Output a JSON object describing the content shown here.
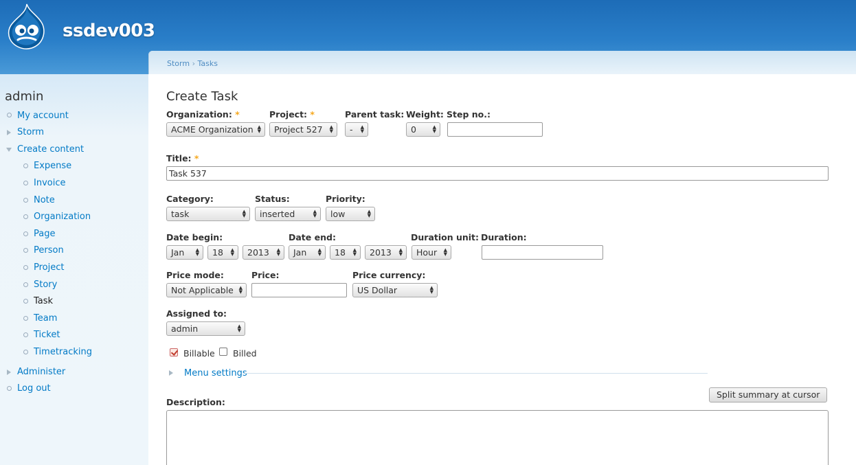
{
  "site": {
    "name": "ssdev003"
  },
  "sidebar": {
    "title": "admin",
    "items": [
      {
        "label": "My account"
      },
      {
        "label": "Storm"
      },
      {
        "label": "Create content"
      },
      {
        "label": "Expense"
      },
      {
        "label": "Invoice"
      },
      {
        "label": "Note"
      },
      {
        "label": "Organization"
      },
      {
        "label": "Page"
      },
      {
        "label": "Person"
      },
      {
        "label": "Project"
      },
      {
        "label": "Story"
      },
      {
        "label": "Task"
      },
      {
        "label": "Team"
      },
      {
        "label": "Ticket"
      },
      {
        "label": "Timetracking"
      },
      {
        "label": "Administer"
      },
      {
        "label": "Log out"
      }
    ]
  },
  "breadcrumb": {
    "root": "Storm",
    "separator": "›",
    "current": "Tasks"
  },
  "page": {
    "title": "Create Task"
  },
  "form": {
    "required_mark": "*",
    "organization": {
      "label": "Organization:",
      "value": "ACME Organization"
    },
    "project": {
      "label": "Project:",
      "value": "Project 527"
    },
    "parent_task": {
      "label": "Parent task:",
      "value": "-"
    },
    "weight": {
      "label": "Weight:",
      "value": "0"
    },
    "step_no": {
      "label": "Step no.:",
      "value": ""
    },
    "title": {
      "label": "Title:",
      "value": "Task 537"
    },
    "category": {
      "label": "Category:",
      "value": "task"
    },
    "status": {
      "label": "Status:",
      "value": "inserted"
    },
    "priority": {
      "label": "Priority:",
      "value": "low"
    },
    "date_begin": {
      "label": "Date begin:",
      "month": "Jan",
      "day": "18",
      "year": "2013"
    },
    "date_end": {
      "label": "Date end:",
      "month": "Jan",
      "day": "18",
      "year": "2013"
    },
    "duration_unit": {
      "label": "Duration unit:",
      "value": "Hour"
    },
    "duration": {
      "label": "Duration:",
      "value": ""
    },
    "price_mode": {
      "label": "Price mode:",
      "value": "Not Applicable"
    },
    "price": {
      "label": "Price:",
      "value": ""
    },
    "price_currency": {
      "label": "Price currency:",
      "value": "US Dollar"
    },
    "assigned_to": {
      "label": "Assigned to:",
      "value": "admin"
    },
    "billable": {
      "label": "Billable",
      "checked": true
    },
    "billed": {
      "label": "Billed",
      "checked": false
    },
    "menu_settings": {
      "label": "Menu settings"
    },
    "description": {
      "label": "Description:"
    },
    "split_summary": {
      "label": "Split summary at cursor"
    }
  },
  "colors": {
    "header": "#2a7fc9",
    "link": "#027ac6",
    "required": "#f6a81f"
  }
}
